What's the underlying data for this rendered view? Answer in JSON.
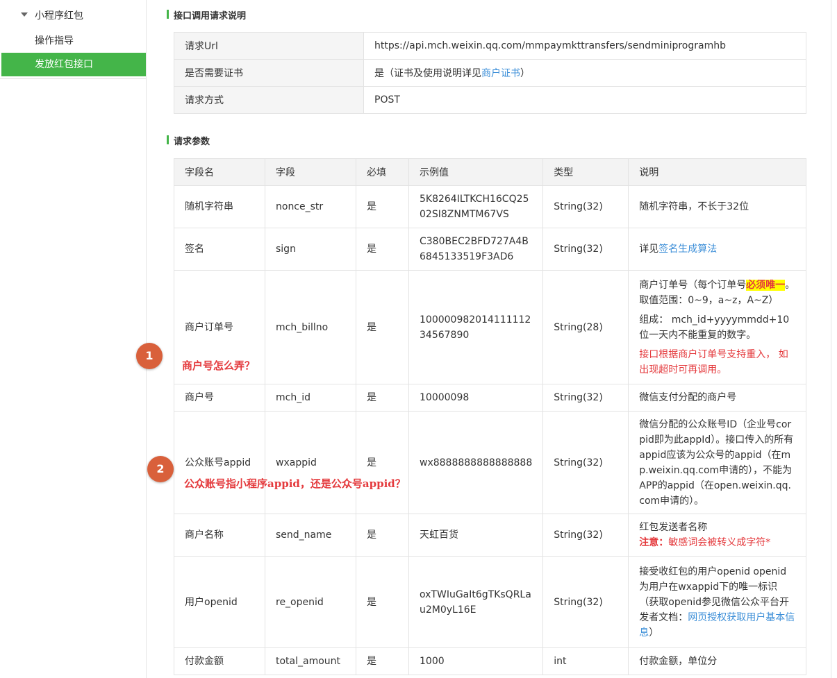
{
  "sidebar": {
    "group_label": "小程序红包",
    "items": [
      {
        "label": "操作指导",
        "active": false
      },
      {
        "label": "发放红包接口",
        "active": true
      }
    ]
  },
  "request_section": {
    "title": "接口调用请求说明",
    "rows": [
      {
        "key": "请求Url",
        "value": "https://api.mch.weixin.qq.com/mmpaymkttransfers/sendminiprogramhb"
      },
      {
        "key": "是否需要证书",
        "value_prefix": "是（证书及使用说明详见",
        "value_link": "商户证书",
        "value_suffix": "）"
      },
      {
        "key": "请求方式",
        "value": "POST"
      }
    ]
  },
  "params_section": {
    "title": "请求参数",
    "headers": [
      "字段名",
      "字段",
      "必填",
      "示例值",
      "类型",
      "说明"
    ],
    "rows": [
      {
        "name": "随机字符串",
        "field": "nonce_str",
        "required": "是",
        "example": "5K8264ILTKCH16CQ2502SI8ZNMTM67VS",
        "type": "String(32)",
        "desc": "随机字符串，不长于32位"
      },
      {
        "name": "签名",
        "field": "sign",
        "required": "是",
        "example": "C380BEC2BFD727A4B6845133519F3AD6",
        "type": "String(32)",
        "desc_prefix": "详见",
        "desc_link": "签名生成算法"
      },
      {
        "name": "商户订单号",
        "field": "mch_billno",
        "required": "是",
        "example": "10000098201411111234567890",
        "type": "String(28)",
        "desc_1a": "商户订单号（每个订单号",
        "desc_1b": "必须唯一",
        "desc_1c": "。取值范围：0~9，a~z，A~Z）",
        "desc_2": "组成： mch_id+yyyymmdd+10位一天内不能重复的数字。",
        "desc_3": "接口根据商户订单号支持重入， 如出现超时可再调用。"
      },
      {
        "name": "商户号",
        "field": "mch_id",
        "required": "是",
        "example": "10000098",
        "type": "String(32)",
        "desc": "微信支付分配的商户号"
      },
      {
        "name": "公众账号appid",
        "field": "wxappid",
        "required": "是",
        "example": "wx8888888888888888",
        "type": "String(32)",
        "desc": "微信分配的公众账号ID（企业号corpid即为此appId）。接口传入的所有appid应该为公众号的appid（在mp.weixin.qq.com申请的），不能为APP的appid（在open.weixin.qq.com申请的）。"
      },
      {
        "name": "商户名称",
        "field": "send_name",
        "required": "是",
        "example": "天虹百货",
        "type": "String(32)",
        "desc": "红包发送者名称",
        "desc_note_b": "注意：",
        "desc_note": "敏感词会被转义成字符*"
      },
      {
        "name": "用户openid",
        "field": "re_openid",
        "required": "是",
        "example": "oxTWIuGaIt6gTKsQRLau2M0yL16E",
        "type": "String(32)",
        "desc_prefix": "接受收红包的用户openid openid为用户在wxappid下的唯一标识（获取openid参见微信公众平台开发者文档：",
        "desc_link": "网页授权获取用户基本信息",
        "desc_suffix": "）"
      },
      {
        "name": "付款金额",
        "field": "total_amount",
        "required": "是",
        "example": "1000",
        "type": "int",
        "desc": "付款金额，单位分"
      }
    ]
  },
  "annotations": [
    {
      "badge": "1",
      "text": "商户号怎么弄？"
    },
    {
      "badge": "2",
      "text": "公众账号指小程序appid，还是公众号appid？"
    }
  ],
  "colors": {
    "accent": "#44b549",
    "link": "#3d8fd8",
    "warn": "#e4393c",
    "badge": "#d9603b"
  }
}
